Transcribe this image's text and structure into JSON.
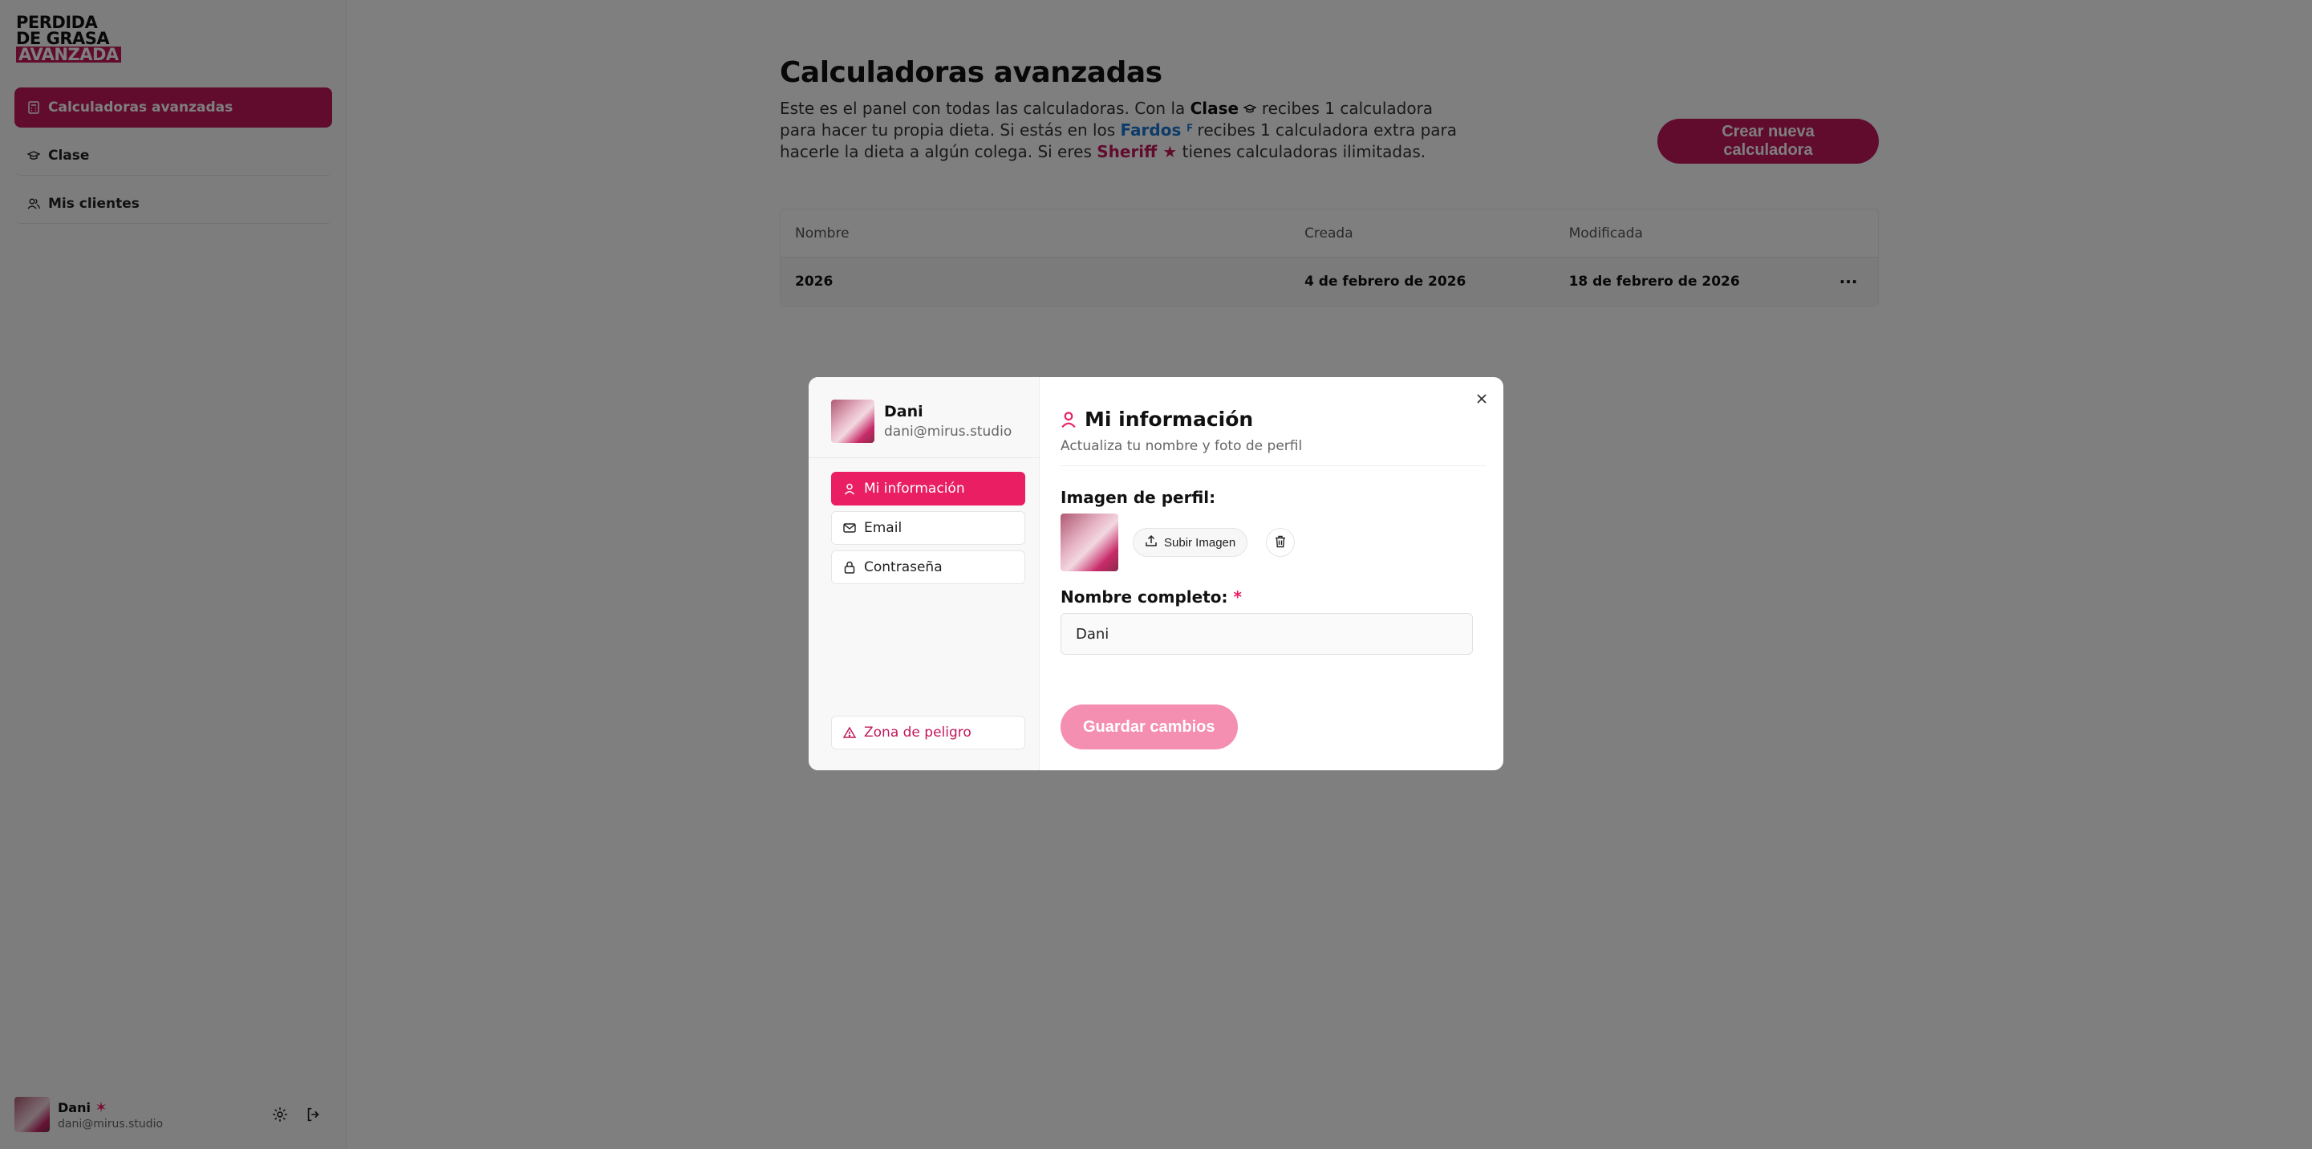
{
  "logo": {
    "line1": "PERDIDA",
    "line2": "DE GRASA",
    "line3": "AVANZADA"
  },
  "sidebar": {
    "items": [
      {
        "label": "Calculadoras avanzadas",
        "icon": "calculator-icon",
        "active": true
      },
      {
        "label": "Clase",
        "icon": "graduation-cap-icon",
        "active": false
      },
      {
        "label": "Mis clientes",
        "icon": "users-icon",
        "active": false
      }
    ],
    "user": {
      "name": "Dani",
      "badge": "✶",
      "email": "dani@mirus.studio"
    }
  },
  "main": {
    "title": "Calculadoras avanzadas",
    "desc": {
      "p1": "Este es el panel con todas las calculadoras. Con la ",
      "clase": "Clase",
      "p2": " recibes 1 calculadora para hacer tu propia dieta. Si estás en los ",
      "fardos": "Fardos",
      "p3": " recibes 1 calculadora extra para hacerle la dieta a algún colega. Si eres ",
      "sheriff": "Sheriff",
      "p4": " tienes calculadoras ilimitadas."
    },
    "new_button": "Crear nueva calculadora",
    "table": {
      "headers": [
        "Nombre",
        "Creada",
        "Modificada"
      ],
      "rows": [
        {
          "nombre": "2026",
          "creada": "4 de febrero de 2026",
          "modificada": "18 de febrero de 2026",
          "menu": "···"
        }
      ]
    }
  },
  "modal": {
    "user": {
      "name": "Dani",
      "email": "dani@mirus.studio"
    },
    "nav": [
      {
        "label": "Mi información",
        "icon": "user-icon",
        "active": true
      },
      {
        "label": "Email",
        "icon": "mail-icon",
        "active": false
      },
      {
        "label": "Contraseña",
        "icon": "lock-icon",
        "active": false
      }
    ],
    "danger": "Zona de peligro",
    "title": "Mi información",
    "subtitle": "Actualiza tu nombre y foto de perfil",
    "profile_image_label": "Imagen de perfil:",
    "upload_button": "Subir Imagen",
    "name_label": "Nombre completo:",
    "required_mark": "*",
    "name_value": "Dani",
    "save_button": "Guardar cambios"
  },
  "colors": {
    "brand": "#c2185b",
    "accent": "#e91e63",
    "link_blue": "#1976d2",
    "save_disabled": "#f48fb1"
  }
}
